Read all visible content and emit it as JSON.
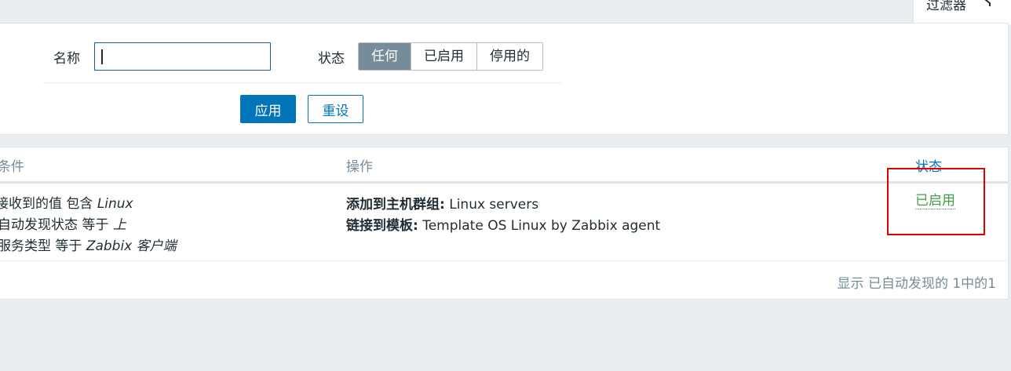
{
  "filter": {
    "tab_label": "过滤器",
    "funnel_icon": "funnel-icon",
    "name_label": "名称",
    "name_value": "",
    "status_label": "状态",
    "status_options": [
      "任何",
      "已启用",
      "停用的"
    ],
    "status_selected": "任何",
    "apply_label": "应用",
    "reset_label": "重设"
  },
  "table": {
    "headers": {
      "conditions": "条件",
      "operations": "操作",
      "status": "状态"
    },
    "row": {
      "conditions": [
        {
          "field": "接收到的值",
          "op": "包含",
          "value": "Linux"
        },
        {
          "field": "自动发现状态",
          "op": "等于",
          "value": "上"
        },
        {
          "field": "服务类型",
          "op": "等于",
          "value": "Zabbix 客户端"
        }
      ],
      "operations": [
        {
          "label": "添加到主机群组:",
          "value": "Linux servers"
        },
        {
          "label": "链接到模板:",
          "value": "Template OS Linux by Zabbix agent"
        }
      ],
      "status": "已启用"
    },
    "footer": "显示 已自动发现的 1中的1"
  },
  "colors": {
    "accent": "#0275b8",
    "enabled": "#429e47",
    "highlight": "#e00000"
  }
}
